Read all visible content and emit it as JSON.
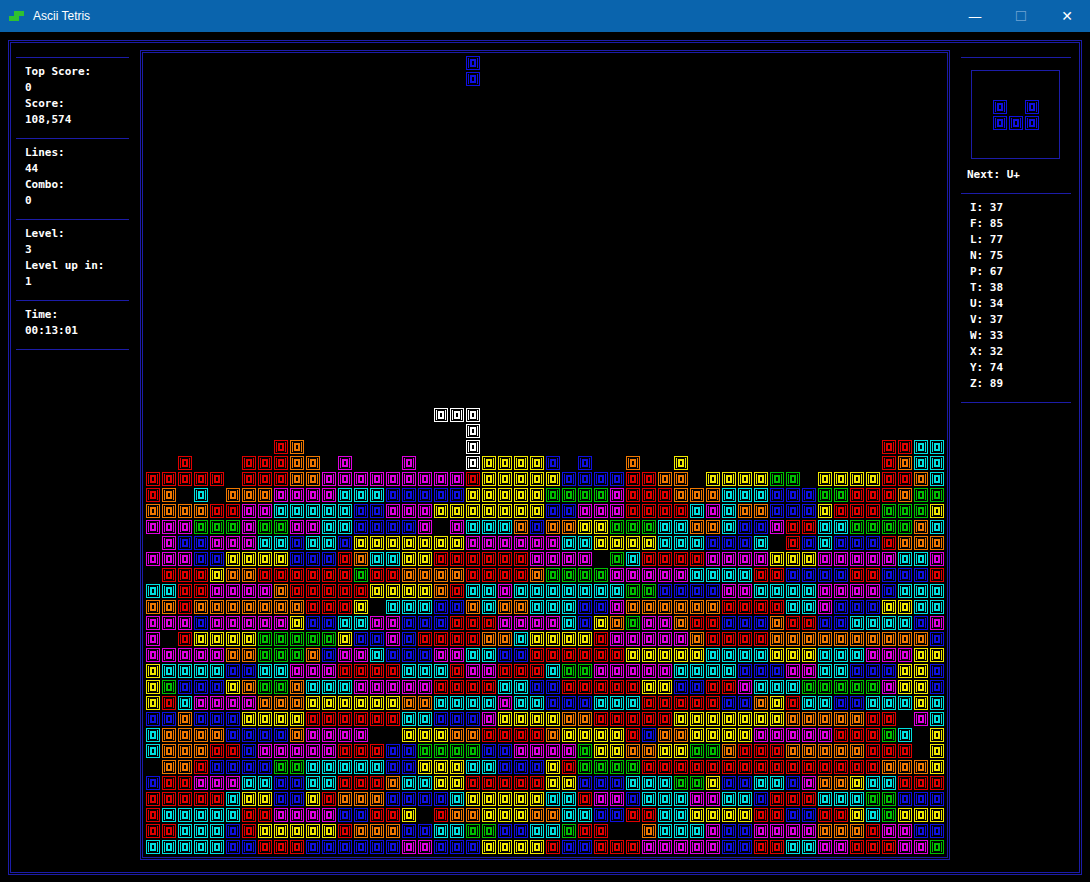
{
  "window": {
    "title": "Ascii Tetris",
    "controls": [
      {
        "label": "—",
        "disabled": false
      },
      {
        "label": "☐",
        "disabled": true
      },
      {
        "label": "✕",
        "disabled": false
      }
    ]
  },
  "stats": [
    {
      "items": [
        {
          "label": "Top Score:",
          "value": "0"
        },
        {
          "label": "Score:",
          "value": "108,574"
        }
      ]
    },
    {
      "items": [
        {
          "label": "Lines:",
          "value": "44"
        },
        {
          "label": "Combo:",
          "value": "0"
        }
      ]
    },
    {
      "items": [
        {
          "label": "Level:",
          "value": "3"
        },
        {
          "label": "Level up in:",
          "value": "1"
        }
      ]
    },
    {
      "items": [
        {
          "label": "Time:",
          "value": "00:13:01"
        }
      ]
    }
  ],
  "palette": {
    "r": "#e00000",
    "o": "#f07800",
    "y": "#f0e800",
    "g": "#00c000",
    "c": "#00e0e0",
    "b": "#1010e0",
    "m": "#e000e0",
    "w": "#ffffff"
  },
  "board": {
    "rows": [
      "....................b.............................",
      "....................b.............................",
      "..................................................",
      "..................................................",
      "..................................................",
      "..................................................",
      "..................................................",
      "..................................................",
      "..................................................",
      "..................................................",
      "..................................................",
      "..................................................",
      "..................................................",
      "..................................................",
      "..................................................",
      "..................................................",
      "..................................................",
      "..................................................",
      "..................................................",
      "..................................................",
      "..................................................",
      "..................................................",
      "..................www.............................",
      "....................w.............................",
      "........ro..........w.........................rrcc",
      "..r...rrroo.m...m...wyyyyb.b..o..y............rocc",
      "rrrrr.rrroommmmmmmmmryyyyybbbbrroo.yyyygg.yyyyrroc",
      "ro.c.ooommmmcccbbbbbyyyyyggggmrrrooocccbbbggrrrogg",
      "oooorrmmcccccbbmmmyyyyyyybbmmmrrrrcmcoobbbyrrrgggy",
      "mmmgggmggmmccbbbbm.mcccobooyygggccoocbbmrrccggggoc",
      ".mbbmmmccbccbyyyyyyymmmmmmccyyyycccbbbc.rbcbbbrooo",
      "mmmbbyyyybbbroccyyrrrrrrmmmm.gcrrrrmmmmyyymmmmmccm",
      ".rrryoorrrrrrgrroooorrrroggggmmmmmccccrrbbbbrrbbbr",
      "ccrrmmmmorrrrryyyyorccmcccccccggbbbbmmccccmmmmbccc",
      "oorooooooorrry.cccbbocoocccbbmoooooorrrrccmbbbyycc",
      "mmmbmmmmmybbccmmbbbrrrmmmmcbyogmmorrbbborrbbccccbm",
      "m.ryyyygggggybbmbrrrroocyyyyrmmmmmorrrroooooooooobb",
      "mmmmmoogggobmmcbbbmmccbbrrrrrryyyyyccccyyycccmmmyy",
      "yccccbbccmmmrrrrcccrmmrrrcggmmmmmccccbbbmmccbbbyyb",
      "ygbbbyoggocccmmmmmrrrrccbbrrrrryybbrrmcccgggggmyyb",
      "yrcmmmmoooyyyyyyooccccmccbbbcccrrrrrbboyrccbbcccycc",
      "bbobbbyyyyrrrrrrccbbbmyyyyoorrrrryyyyyyyooooorr.mc",
      "coooobbbbommmm..yyyoorrrroyyyyrbooyyyymmmmmrrrgc.y",
      "cooorrbmmmmmrrrbbggggbbmmmmgyyooyyggorrrooooorrr.y",
      ".oorbbbbggcccccbbyyyccbbbyrggggrrrrrrrrrrrrrrroooy",
      "brrmmmccbbccrrroccyyrrrrryybbbcccggybbccbmooyccrrr",
      "rrrrrcyybbyrooobbbbcyyyyyccrmmbcccmmccbrrrcccggbbb",
      "rcccccrrmmmmbbrry.rooyyyooccbbrrccyyyyrrbbrrycgyyy",
      "rrcccbryyyyyrooobbccggbbccgrr..occcmbbmmmmooormmbb",
      "cccccbbrrrbbbbbbmmbbbyyyyrbbrrrmmmmmbbrrccmmrrrmmg"
    ]
  },
  "next": {
    "label": "Next: U+",
    "rows": [
      "b.b",
      "bbb"
    ]
  },
  "piece_counts": [
    "I: 37",
    "F: 85",
    "L: 77",
    "N: 75",
    "P: 67",
    "T: 38",
    "U: 34",
    "V: 37",
    "W: 33",
    "X: 32",
    "Y: 74",
    "Z: 89"
  ]
}
